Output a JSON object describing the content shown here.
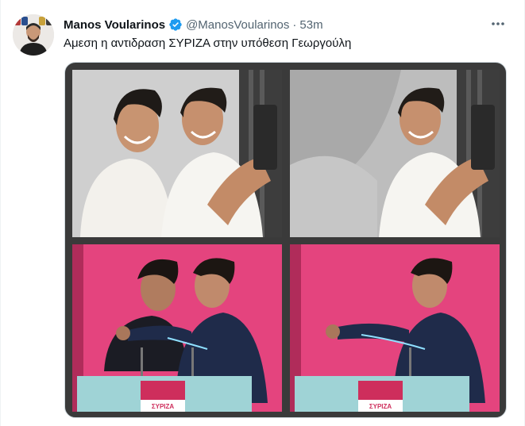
{
  "author": {
    "name": "Manos Voularinos",
    "handle": "@ManosVoularinos",
    "separator": "·",
    "time": "53m",
    "verified": true
  },
  "tweet": {
    "text": "Αμεση η αντιδραση ΣΥΡΙΖΑ στην υπόθεση Γεωργούλη"
  },
  "icons": {
    "avatar": "avatar-photo",
    "verified": "verified-badge-icon",
    "more": "more-horizontal-icon"
  },
  "media": {
    "images": [
      "selfie-original",
      "selfie-edited",
      "embrace-original",
      "embrace-edited"
    ],
    "podium_label": "ΣΥΡΙΖΑ"
  },
  "colors": {
    "verified_blue": "#1d9bf0",
    "secondary_text": "#536471",
    "stage_pink": "#e4447e"
  }
}
